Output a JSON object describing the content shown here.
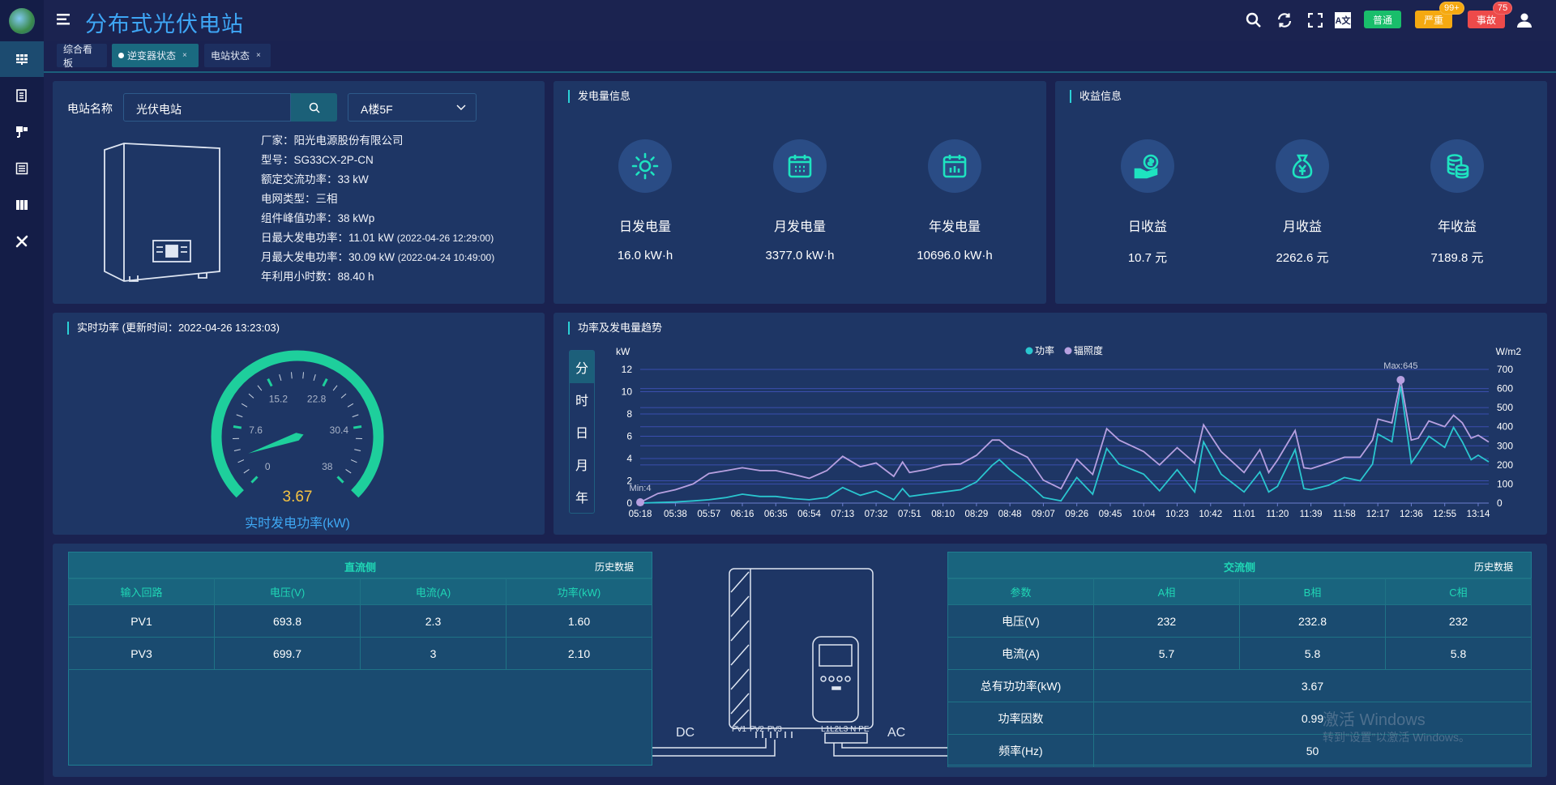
{
  "app": {
    "title": "分布式光伏电站"
  },
  "sidebar": {
    "items": [
      {
        "icon": "dashboard-grid-icon"
      },
      {
        "icon": "report-icon"
      },
      {
        "icon": "monitor-icon"
      },
      {
        "icon": "list-icon"
      },
      {
        "icon": "library-icon"
      },
      {
        "icon": "tools-icon"
      }
    ]
  },
  "header": {
    "icons": [
      "search-icon",
      "refresh-icon",
      "fullscreen-icon",
      "translate-icon",
      "user-icon"
    ],
    "translate_glyph": "A文",
    "alarms": [
      {
        "label": "普通",
        "color": "#19be6b"
      },
      {
        "label": "严重",
        "color": "#f5a911",
        "count": "99+"
      },
      {
        "label": "事故",
        "color": "#ed4a4a",
        "count": "75"
      }
    ]
  },
  "tabs": [
    {
      "label": "综合看板",
      "closable": false,
      "active": false
    },
    {
      "label": "逆变器状态",
      "closable": true,
      "active": true
    },
    {
      "label": "电站状态",
      "closable": true,
      "active": false
    }
  ],
  "tab_close": "×",
  "station": {
    "name_label": "电站名称",
    "name_value": "光伏电站",
    "select_value": "A楼5F",
    "info": [
      "厂家：阳光电源股份有限公司",
      "型号：SG33CX-2P-CN",
      "额定交流功率：33 kW",
      "电网类型：三相",
      "组件峰值功率：38 kWp"
    ],
    "max_day": {
      "label": "日最大发电功率：11.01 kW ",
      "time": "(2022-04-26 12:29:00)"
    },
    "max_month": {
      "label": "月最大发电功率：30.09 kW ",
      "time": "(2022-04-24 10:49:00)"
    },
    "hours": "年利用小时数：88.40 h"
  },
  "generation": {
    "title": "发电量信息",
    "items": [
      {
        "label": "日发电量",
        "value": "16.0 kW·h",
        "icon": "sun-icon"
      },
      {
        "label": "月发电量",
        "value": "3377.0 kW·h",
        "icon": "calendar-icon"
      },
      {
        "label": "年发电量",
        "value": "10696.0 kW·h",
        "icon": "calendar-chart-icon"
      }
    ]
  },
  "income": {
    "title": "收益信息",
    "items": [
      {
        "label": "日收益",
        "value": "10.7 元",
        "icon": "hand-coin-icon"
      },
      {
        "label": "月收益",
        "value": "2262.6 元",
        "icon": "money-bag-icon"
      },
      {
        "label": "年收益",
        "value": "7189.8 元",
        "icon": "coin-stack-icon"
      }
    ]
  },
  "realtime": {
    "title": "实时功率 (更新时间：2022-04-26 13:23:03)",
    "value": "3.67",
    "unit_label": "实时发电功率(kW)",
    "gauge_value": 3.67,
    "min": 0,
    "max": 38,
    "tick_labels": [
      "0",
      "7.6",
      "15.2",
      "22.8",
      "30.4",
      "38"
    ],
    "colors": {
      "arc": "#1ecf9c",
      "value": "#f5c342",
      "label": "#3fa9f5"
    }
  },
  "trend": {
    "title": "功率及发电量趋势",
    "periods": [
      "分",
      "时",
      "日",
      "月",
      "年"
    ],
    "active_period": "分"
  },
  "chart_data": {
    "type": "line",
    "legend": [
      "功率",
      "辐照度"
    ],
    "legend_position": "top-center",
    "ylabel_left": "kW",
    "ylabel_right": "W/m2",
    "ylim_left": [
      0,
      12
    ],
    "yticks_left": [
      "0",
      "2",
      "4",
      "6",
      "8",
      "10",
      "12"
    ],
    "ylim_right": [
      0,
      700
    ],
    "yticks_right": [
      "0",
      "100",
      "200",
      "300",
      "400",
      "500",
      "600",
      "700"
    ],
    "xlim": [
      "05:18",
      "13:20"
    ],
    "xticks": [
      "05:18",
      "05:38",
      "05:57",
      "06:16",
      "06:35",
      "06:54",
      "07:13",
      "07:32",
      "07:51",
      "08:10",
      "08:29",
      "08:48",
      "09:07",
      "09:26",
      "09:45",
      "10:04",
      "10:23",
      "10:42",
      "11:01",
      "11:20",
      "11:39",
      "11:58",
      "12:17",
      "12:36",
      "12:55",
      "13:14"
    ],
    "grid": true,
    "x": [
      "05:18",
      "05:28",
      "05:38",
      "05:48",
      "05:57",
      "06:07",
      "06:16",
      "06:26",
      "06:35",
      "06:45",
      "06:54",
      "07:04",
      "07:13",
      "07:23",
      "07:32",
      "07:42",
      "07:47",
      "07:51",
      "08:00",
      "08:10",
      "08:20",
      "08:29",
      "08:38",
      "08:42",
      "08:48",
      "08:58",
      "09:07",
      "09:17",
      "09:26",
      "09:35",
      "09:43",
      "09:50",
      "10:04",
      "10:13",
      "10:23",
      "10:33",
      "10:38",
      "10:48",
      "11:01",
      "11:10",
      "11:15",
      "11:20",
      "11:30",
      "11:35",
      "11:39",
      "11:49",
      "11:58",
      "12:07",
      "12:14",
      "12:17",
      "12:25",
      "12:30",
      "12:36",
      "12:40",
      "12:46",
      "12:55",
      "13:00",
      "13:05",
      "13:10",
      "13:14",
      "13:20"
    ],
    "series": [
      {
        "name": "功率",
        "axis": "left",
        "color": "#2ac6cf",
        "values": [
          0,
          0.05,
          0.1,
          0.2,
          0.3,
          0.5,
          0.8,
          0.6,
          0.6,
          0.4,
          0.3,
          0.5,
          1.4,
          0.7,
          1.1,
          0.3,
          1.3,
          0.6,
          0.8,
          1.0,
          1.2,
          1.9,
          3.4,
          3.9,
          3.0,
          1.8,
          0.5,
          0.2,
          2.3,
          0.8,
          4.9,
          3.5,
          2.6,
          1.1,
          3.0,
          1.0,
          5.5,
          2.6,
          1.0,
          2.8,
          1.0,
          1.5,
          4.8,
          1.3,
          1.2,
          1.6,
          2.3,
          2.0,
          3.5,
          6.2,
          5.5,
          10.5,
          3.6,
          4.5,
          6.0,
          5.0,
          6.8,
          5.5,
          3.9,
          4.3,
          3.7
        ]
      },
      {
        "name": "辐照度",
        "axis": "right",
        "color": "#b7a0e0",
        "values": [
          4,
          50,
          70,
          100,
          155,
          170,
          185,
          170,
          170,
          150,
          130,
          170,
          245,
          190,
          210,
          140,
          215,
          160,
          175,
          200,
          205,
          250,
          330,
          330,
          285,
          240,
          120,
          75,
          230,
          150,
          390,
          330,
          270,
          200,
          290,
          210,
          410,
          270,
          160,
          280,
          160,
          225,
          380,
          185,
          180,
          210,
          240,
          240,
          330,
          440,
          420,
          645,
          330,
          340,
          430,
          400,
          460,
          420,
          340,
          355,
          320
        ]
      }
    ],
    "annotations": [
      {
        "label": "Max:645",
        "series": "辐照度",
        "x": "12:30",
        "y": 645
      },
      {
        "label": "Min:4",
        "series": "辐照度",
        "x": "05:18",
        "y": 4
      }
    ]
  },
  "dc": {
    "title": "直流侧",
    "history": "历史数据",
    "columns": [
      "输入回路",
      "电压(V)",
      "电流(A)",
      "功率(kW)"
    ],
    "rows": [
      [
        "PV1",
        "693.8",
        "2.3",
        "1.60"
      ],
      [
        "PV3",
        "699.7",
        "3",
        "2.10"
      ]
    ]
  },
  "ac": {
    "title": "交流侧",
    "history": "历史数据",
    "columns": [
      "参数",
      "A相",
      "B相",
      "C相"
    ],
    "rows": [
      [
        "电压(V)",
        "232",
        "232.8",
        "232"
      ],
      [
        "电流(A)",
        "5.7",
        "5.8",
        "5.8"
      ]
    ],
    "merged_rows": [
      [
        "总有功功率(kW)",
        "3.67"
      ],
      [
        "功率因数",
        "0.99"
      ],
      [
        "频率(Hz)",
        "50"
      ]
    ]
  },
  "diagram": {
    "dc_label": "DC",
    "ac_label": "AC",
    "pv_ports": "PV1  PV2  PV3",
    "ac_ports": "L1L2L3 N PE"
  },
  "watermark": {
    "line1": "激活 Windows",
    "line2": "转到“设置”以激活 Windows。"
  }
}
